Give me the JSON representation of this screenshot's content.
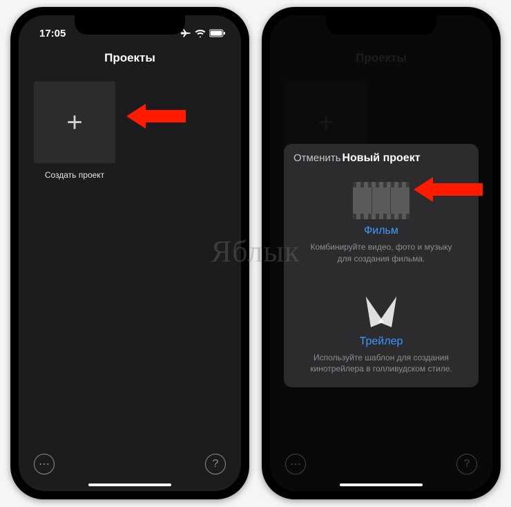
{
  "watermark": "Яблык",
  "phone1": {
    "status": {
      "time": "17:05"
    },
    "header": "Проекты",
    "create_label": "Создать проект"
  },
  "phone2": {
    "header": "Проекты",
    "sheet": {
      "cancel": "Отменить",
      "title": "Новый проект",
      "movie": {
        "title": "Фильм",
        "desc": "Комбинируйте видео, фото и музыку для создания фильма."
      },
      "trailer": {
        "title": "Трейлер",
        "desc": "Используйте шаблон для создания кинотрейлера в голливудском стиле."
      }
    }
  }
}
